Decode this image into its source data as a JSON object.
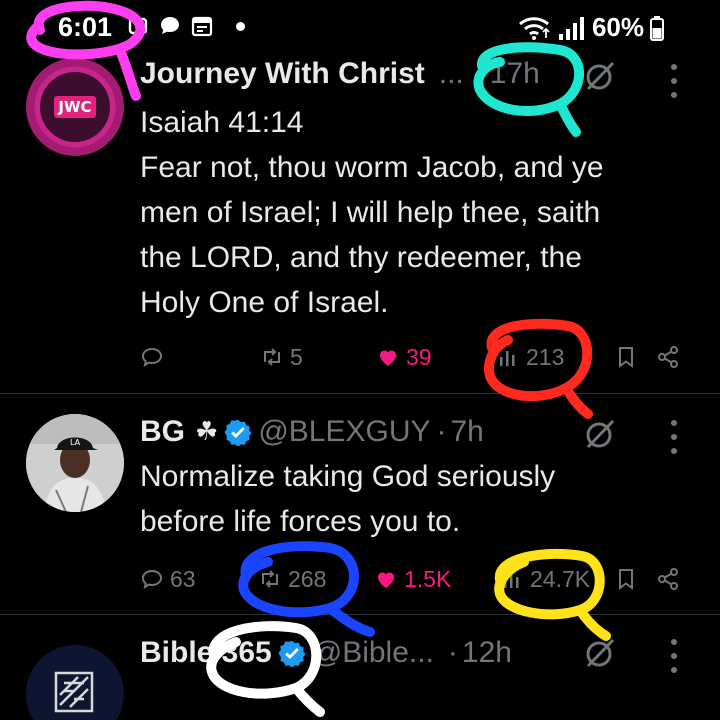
{
  "status_bar": {
    "time": "6:01",
    "battery": "60%"
  },
  "tweets": [
    {
      "name": "Journey With Christ",
      "handle_truncated": "...",
      "time": "17h",
      "avatar_text": "JWC",
      "text_lines": [
        "Isaiah 41:14",
        "Fear not, thou worm Jacob, and ye",
        "men of Israel; I will help thee, saith",
        "the LORD, and thy redeemer, the",
        "Holy One of Israel."
      ],
      "replies": "",
      "reposts": "5",
      "likes": "39",
      "views": "213"
    },
    {
      "name": "BG",
      "name_symbol": "☘",
      "handle": "@BLEXGUY",
      "time": "7h",
      "text_lines": [
        "Normalize taking God seriously",
        "before life forces you to."
      ],
      "replies": "63",
      "reposts": "268",
      "likes": "1.5K",
      "views": "24.7K"
    },
    {
      "name": "Bible 365",
      "handle": "@Bible...",
      "time": "12h"
    }
  ],
  "colors": {
    "like": "#f91880",
    "verified": "#1d9bf0",
    "muted": "#71767b"
  }
}
